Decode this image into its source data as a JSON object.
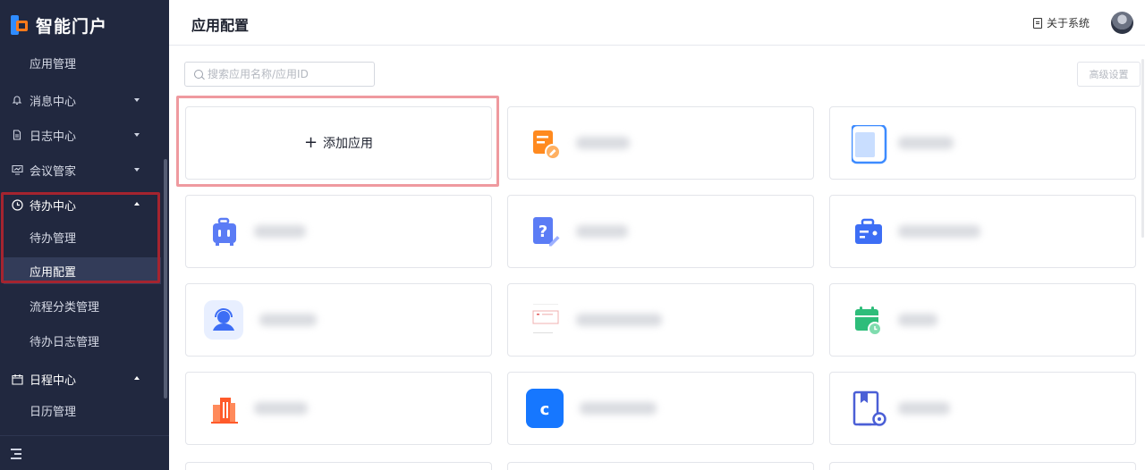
{
  "app": {
    "title": "智能门户"
  },
  "sidebar": {
    "items": [
      {
        "label": "应用管理",
        "type": "sub"
      },
      {
        "label": "消息中心",
        "type": "group",
        "icon": "bell-icon",
        "expanded": false
      },
      {
        "label": "日志中心",
        "type": "group",
        "icon": "document-icon",
        "expanded": false
      },
      {
        "label": "会议管家",
        "type": "group",
        "icon": "chart-board-icon",
        "expanded": false
      },
      {
        "label": "待办中心",
        "type": "group",
        "icon": "clock-icon",
        "expanded": true
      },
      {
        "label": "待办管理",
        "type": "sub"
      },
      {
        "label": "应用配置",
        "type": "sub",
        "active": true
      },
      {
        "label": "流程分类管理",
        "type": "sub"
      },
      {
        "label": "待办日志管理",
        "type": "sub"
      },
      {
        "label": "日程中心",
        "type": "group",
        "icon": "calendar-icon",
        "expanded": true
      },
      {
        "label": "日历管理",
        "type": "sub"
      }
    ],
    "collapse_icon": "menu-collapse-icon"
  },
  "header": {
    "title": "应用配置",
    "about_label": "关于系统"
  },
  "main": {
    "search_placeholder": "搜索应用名称/应用ID",
    "advanced_label": "高级设置",
    "add_app_label": "添加应用",
    "apps": [
      {
        "icon": "orange-form-icon",
        "color": "#ff8a1f"
      },
      {
        "icon": "blue-tablet-icon",
        "color": "#3d8bff"
      },
      {
        "icon": "luggage-icon",
        "color": "#5b7cf5"
      },
      {
        "icon": "help-doc-icon",
        "color": "#5b7cf5"
      },
      {
        "icon": "id-card-icon",
        "color": "#3d6ef5"
      },
      {
        "icon": "headset-agent-icon",
        "color": "#3d6ef5"
      },
      {
        "icon": "form-thumbnail-icon",
        "color": "#e35b5b"
      },
      {
        "icon": "calendar-clock-icon",
        "color": "#2ebd7a"
      },
      {
        "icon": "building-icon",
        "color": "#ff6a3d"
      },
      {
        "icon": "c-letter-icon",
        "color": "#1677ff"
      },
      {
        "icon": "book-gear-icon",
        "color": "#4b5fd6"
      }
    ]
  }
}
